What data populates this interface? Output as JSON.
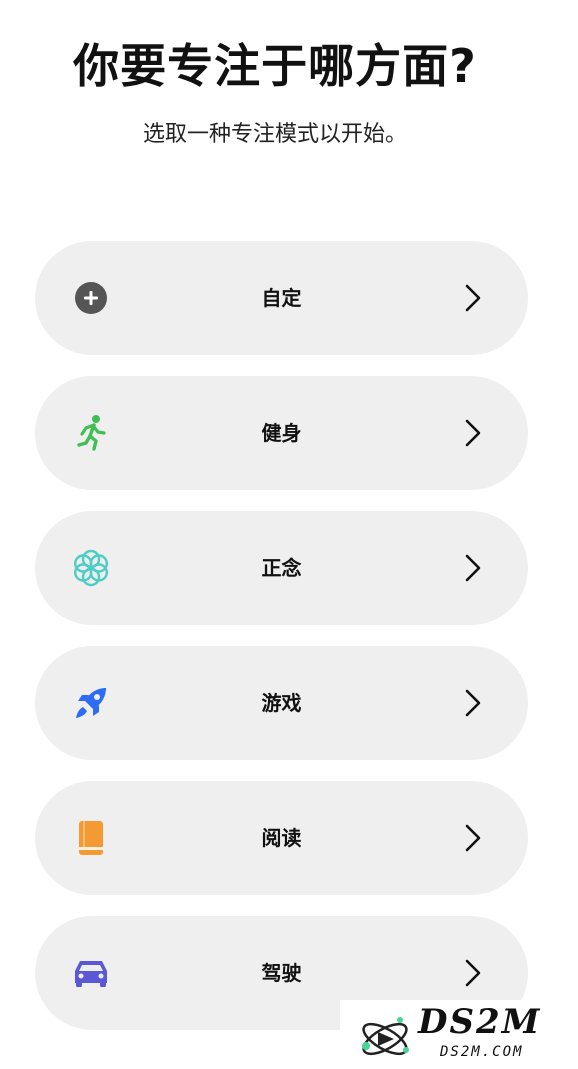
{
  "header": {
    "title": "你要专注于哪方面?",
    "subtitle": "选取一种专注模式以开始。"
  },
  "modes": [
    {
      "label": "自定",
      "icon": "plus-circle-icon",
      "color": "#555555"
    },
    {
      "label": "健身",
      "icon": "runner-icon",
      "color": "#3fbf55"
    },
    {
      "label": "正念",
      "icon": "flower-icon",
      "color": "#4ecdc4"
    },
    {
      "label": "游戏",
      "icon": "rocket-icon",
      "color": "#2f6cf5"
    },
    {
      "label": "阅读",
      "icon": "book-icon",
      "color": "#f39a32"
    },
    {
      "label": "驾驶",
      "icon": "car-icon",
      "color": "#5b57d6"
    }
  ],
  "watermark": {
    "brand": "DS2M",
    "domain": "DS2M.COM"
  }
}
